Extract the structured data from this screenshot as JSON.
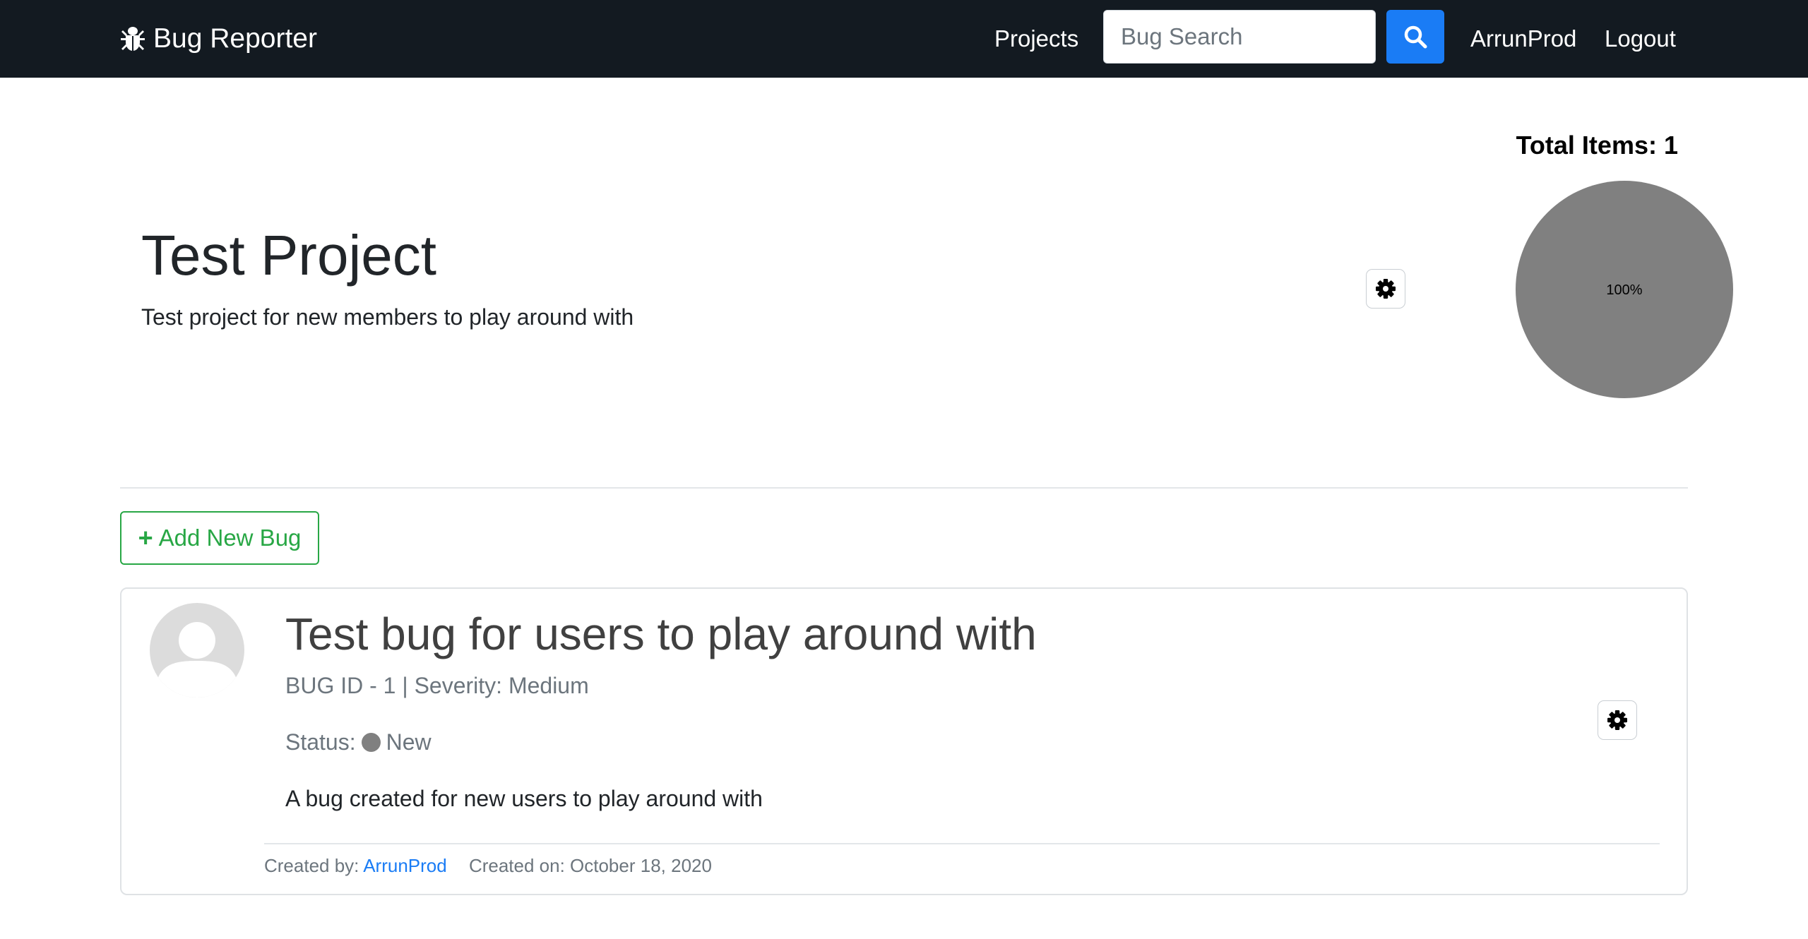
{
  "navbar": {
    "brand": "Bug Reporter",
    "brand_icon": "bug-icon",
    "projects_label": "Projects",
    "search_placeholder": "Bug Search",
    "search_icon": "search-icon",
    "user_label": "ArrunProd",
    "logout_label": "Logout",
    "colors": {
      "background": "#131a21",
      "search_button": "#1a7cf5"
    }
  },
  "project": {
    "title": "Test Project",
    "description": "Test project for new members to play around with",
    "settings_icon": "gear-icon"
  },
  "summary": {
    "total_items": "Total Items: 1"
  },
  "chart_data": {
    "type": "pie",
    "title": "Total Items: 1",
    "slices": [
      {
        "label": "100%",
        "value": 100,
        "color": "#808080"
      }
    ]
  },
  "actions": {
    "add_bug_label": "Add New Bug",
    "add_bug_icon": "plus-icon",
    "add_bug_color": "#28a745"
  },
  "bugs": [
    {
      "title": "Test bug for users to play around with",
      "meta": "BUG ID - 1 | Severity: Medium",
      "status_label": "Status:",
      "status": "New",
      "status_color": "#808080",
      "description": "A bug created for new users to play around with",
      "created_by_label": "Created by:",
      "created_by": "ArrunProd",
      "created_on": "Created on: October 18, 2020",
      "avatar_icon": "user-avatar-icon",
      "settings_icon": "gear-icon"
    }
  ]
}
